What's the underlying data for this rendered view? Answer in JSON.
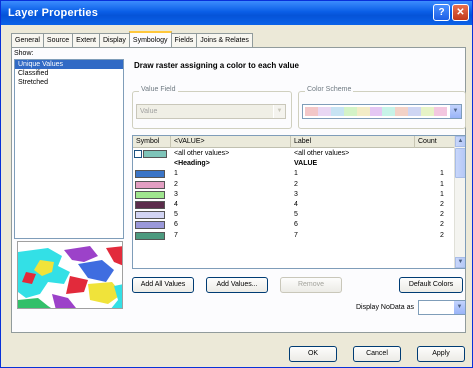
{
  "window": {
    "title": "Layer Properties",
    "help_glyph": "?",
    "close_glyph": "✕"
  },
  "tabs": [
    "General",
    "Source",
    "Extent",
    "Display",
    "Symbology",
    "Fields",
    "Joins & Relates"
  ],
  "active_tab": "Symbology",
  "show": {
    "label": "Show:",
    "items": [
      "Unique Values",
      "Classified",
      "Stretched"
    ],
    "selected": "Unique Values"
  },
  "heading": "Draw raster assigning a color to each value",
  "value_field": {
    "label": "Value Field",
    "value": "Value"
  },
  "color_scheme": {
    "label": "Color Scheme",
    "colors": [
      "#f3c7c8",
      "#e9d7f3",
      "#c7e3f3",
      "#d4f3c7",
      "#f3ecc7",
      "#e4c7f3",
      "#c7f3e8",
      "#f3d2c7",
      "#cfd6f3",
      "#e7f3c7",
      "#f3c7e0"
    ]
  },
  "table": {
    "columns": [
      "Symbol",
      "<VALUE>",
      "Label",
      "Count"
    ],
    "all_other": {
      "value": "<all other values>",
      "label": "<all other values>",
      "color": "#7ec4b9"
    },
    "heading_row": {
      "value": "<Heading>",
      "label": "VALUE"
    },
    "rows": [
      {
        "value": "1",
        "label": "1",
        "count": "1",
        "color": "#3b75c7"
      },
      {
        "value": "2",
        "label": "2",
        "count": "1",
        "color": "#e29ec2"
      },
      {
        "value": "3",
        "label": "3",
        "count": "1",
        "color": "#9fe68e"
      },
      {
        "value": "4",
        "label": "4",
        "count": "2",
        "color": "#5b2c4b"
      },
      {
        "value": "5",
        "label": "5",
        "count": "2",
        "color": "#d2d4f3"
      },
      {
        "value": "6",
        "label": "6",
        "count": "2",
        "color": "#9a98d9"
      },
      {
        "value": "7",
        "label": "7",
        "count": "2",
        "color": "#4c9a7f"
      }
    ]
  },
  "buttons": {
    "add_all_values": "Add All Values",
    "add_values": "Add Values...",
    "remove": "Remove",
    "default_colors": "Default Colors",
    "ok": "OK",
    "cancel": "Cancel",
    "apply": "Apply"
  },
  "nodata": {
    "label": "Display NoData as"
  },
  "colors": {
    "titlebar": "#0a5ee6",
    "selection": "#316ac5",
    "preview_cyan": "#33e0e6",
    "preview_red": "#e22a3b",
    "preview_yellow": "#f0e33a",
    "preview_purple": "#9c42c9",
    "preview_blue": "#3f6de0",
    "preview_green": "#33c06a"
  }
}
